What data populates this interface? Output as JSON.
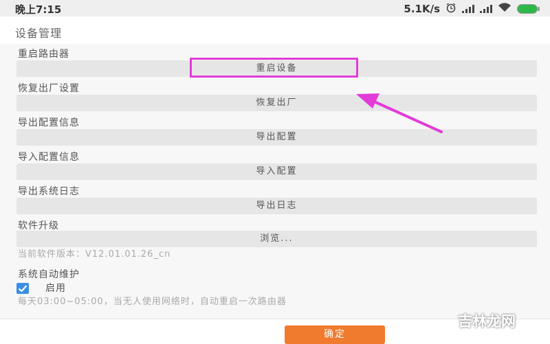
{
  "status_bar": {
    "time": "晚上7:15",
    "speed": "5.1K/s",
    "icons": [
      "alarm-icon",
      "signal-icon",
      "signal-icon",
      "wifi-icon",
      "battery-icon"
    ]
  },
  "header": {
    "title": "设备管理"
  },
  "sections": [
    {
      "label": "重启路由器",
      "button": "重启设备"
    },
    {
      "label": "恢复出厂设置",
      "button": "恢复出厂"
    },
    {
      "label": "导出配置信息",
      "button": "导出配置"
    },
    {
      "label": "导入配置信息",
      "button": "导入配置"
    },
    {
      "label": "导出系统日志",
      "button": "导出日志"
    },
    {
      "label": "软件升级",
      "button": "浏览..."
    }
  ],
  "software": {
    "version_text": "当前软件版本：V12.01.01.26_cn"
  },
  "maintenance": {
    "label": "系统自动维护",
    "enabled": true,
    "enable_label": "启用",
    "description": "每天03:00~05:00，当无人使用网络时，自动重启一次路由器"
  },
  "footer": {
    "confirm_label": "确定"
  },
  "watermark": "吉林龙网",
  "colors": {
    "highlight": "#e23bd8",
    "confirm": "#f07a2e",
    "checkbox": "#3a8ee6"
  }
}
